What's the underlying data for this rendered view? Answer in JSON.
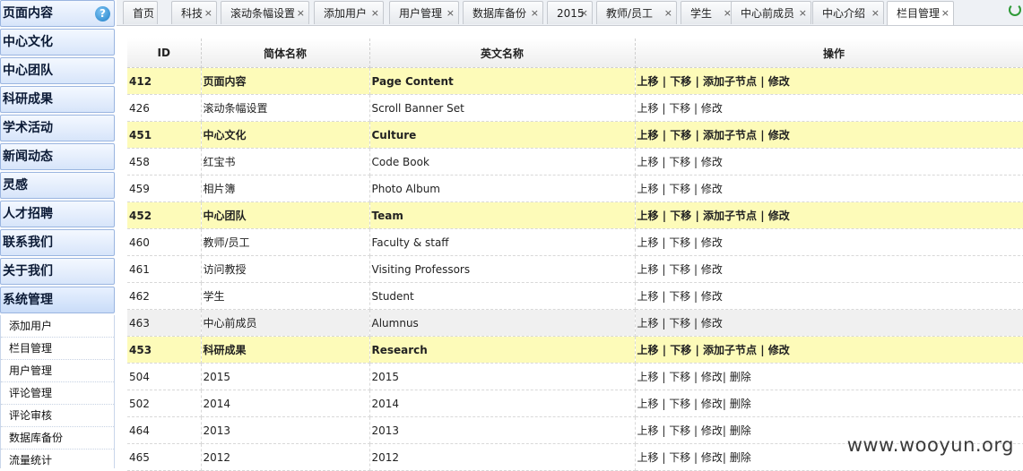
{
  "sidebar": {
    "sections": [
      {
        "label": "页面内容",
        "help": "?"
      },
      {
        "label": "中心文化"
      },
      {
        "label": "中心团队"
      },
      {
        "label": "科研成果"
      },
      {
        "label": "学术活动"
      },
      {
        "label": "新闻动态"
      },
      {
        "label": "灵感"
      },
      {
        "label": "人才招聘"
      },
      {
        "label": "联系我们"
      },
      {
        "label": "关于我们"
      },
      {
        "label": "系统管理"
      }
    ],
    "system_items": [
      "添加用户",
      "栏目管理",
      "用户管理",
      "评论管理",
      "评论审核",
      "数据库备份",
      "流量统计"
    ]
  },
  "tabs": [
    {
      "label": "首页",
      "closable": false
    },
    {
      "label": "科技",
      "closable": true
    },
    {
      "label": "滚动条幅设置",
      "closable": true
    },
    {
      "label": "添加用户",
      "closable": true
    },
    {
      "label": "用户管理",
      "closable": true
    },
    {
      "label": "数据库备份",
      "closable": true
    },
    {
      "label": "2015",
      "closable": true
    },
    {
      "label": "教师/员工",
      "closable": true
    },
    {
      "label": "学生",
      "closable": true
    },
    {
      "label": "中心前成员",
      "closable": true
    },
    {
      "label": "中心介绍",
      "closable": true
    },
    {
      "label": "栏目管理",
      "closable": true,
      "active": true
    }
  ],
  "close_glyph": "×",
  "table": {
    "headers": [
      "ID",
      "简体名称",
      "英文名称",
      "操作"
    ],
    "actions": {
      "up": "上移",
      "down": "下移",
      "add_child": "添加子节点",
      "edit": "修改",
      "delete": "删除",
      "sep": " | "
    },
    "rows": [
      {
        "id": "412",
        "cn": "页面内容",
        "en": "Page Content",
        "type": "parent"
      },
      {
        "id": "426",
        "cn": "滚动条幅设置",
        "en": "Scroll Banner Set",
        "type": "child"
      },
      {
        "id": "451",
        "cn": "中心文化",
        "en": "Culture",
        "type": "parent"
      },
      {
        "id": "458",
        "cn": "红宝书",
        "en": "Code Book",
        "type": "child"
      },
      {
        "id": "459",
        "cn": "相片簿",
        "en": "Photo Album",
        "type": "child"
      },
      {
        "id": "452",
        "cn": "中心团队",
        "en": "Team",
        "type": "parent"
      },
      {
        "id": "460",
        "cn": "教师/员工",
        "en": "Faculty & staff",
        "type": "child"
      },
      {
        "id": "461",
        "cn": "访问教授",
        "en": "Visiting Professors",
        "type": "child"
      },
      {
        "id": "462",
        "cn": "学生",
        "en": "Student",
        "type": "child"
      },
      {
        "id": "463",
        "cn": "中心前成员",
        "en": "Alumnus",
        "type": "child",
        "hover": true
      },
      {
        "id": "453",
        "cn": "科研成果",
        "en": "Research",
        "type": "parent"
      },
      {
        "id": "504",
        "cn": "2015",
        "en": "2015",
        "type": "leaf"
      },
      {
        "id": "502",
        "cn": "2014",
        "en": "2014",
        "type": "leaf"
      },
      {
        "id": "464",
        "cn": "2013",
        "en": "2013",
        "type": "leaf"
      },
      {
        "id": "465",
        "cn": "2012",
        "en": "2012",
        "type": "leaf"
      }
    ]
  },
  "watermark": "www.wooyun.org",
  "colors": {
    "parent_row": "#fdfbb9",
    "hover_row": "#f0f0f0",
    "sidebar_accent": "#c9dcf8"
  }
}
